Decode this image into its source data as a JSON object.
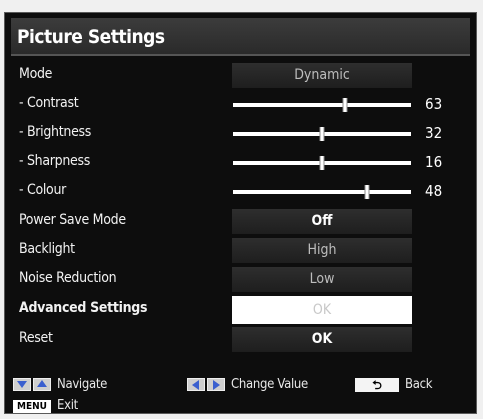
{
  "title": "Picture Settings",
  "rows": [
    {
      "label": "Mode",
      "value": "Dynamic"
    },
    {
      "label": "- Contrast",
      "number": "63",
      "level": 0.63
    },
    {
      "label": "- Brightness",
      "number": "32",
      "level": 0.5
    },
    {
      "label": "- Sharpness",
      "number": "16",
      "level": 0.5
    },
    {
      "label": "- Colour",
      "number": "48",
      "level": 0.75
    },
    {
      "label": "Power Save Mode",
      "value": "Off"
    },
    {
      "label": "Backlight",
      "value": "High"
    },
    {
      "label": "Noise Reduction",
      "value": "Low"
    },
    {
      "label": "Advanced Settings",
      "value": "OK"
    },
    {
      "label": "Reset",
      "value": "OK"
    }
  ],
  "footer": {
    "navigate": "Navigate",
    "change_value": "Change Value",
    "back": "Back",
    "menu_key": "MENU",
    "exit": "Exit"
  },
  "icons": {
    "navigate": "down-up-arrows-icon",
    "change_value": "left-right-arrows-icon",
    "back": "return-arrow-icon"
  },
  "colors": {
    "background": "#0d0d0d",
    "selected": "#ffffff"
  }
}
